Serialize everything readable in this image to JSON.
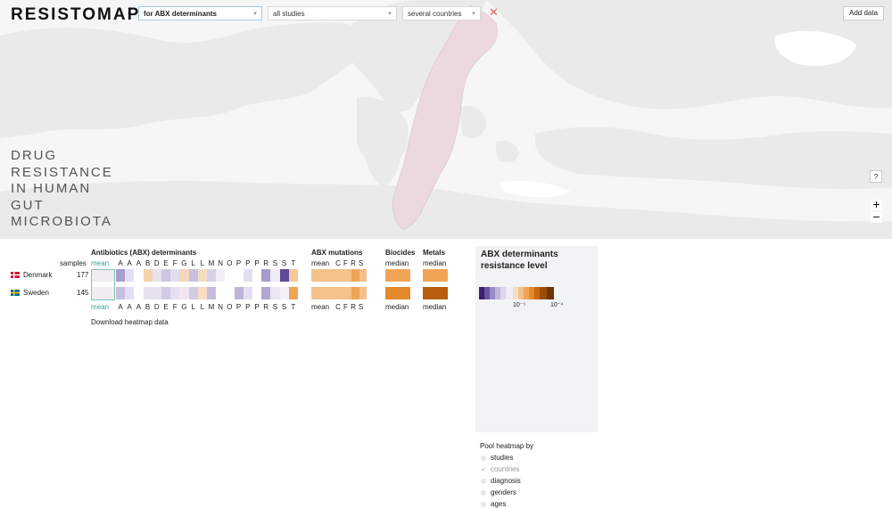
{
  "app": {
    "logo": "RESISTOMAP"
  },
  "filters": {
    "group": "for ABX determinants",
    "studies": "all studies",
    "countries": "several countries",
    "clear_icon": "close-icon"
  },
  "add_data_label": "Add data",
  "tagline": [
    "DRUG",
    "RESISTANCE",
    "IN HUMAN",
    "GUT",
    "MICROBIOTA"
  ],
  "map_controls": {
    "help": "?",
    "zoom_in": "+",
    "zoom_out": "−"
  },
  "heatmap": {
    "section_antibiotics": "Antibiotics (ABX) determinants",
    "section_mutations": "ABX mutations",
    "section_biocides": "Biocides",
    "section_metals": "Metals",
    "samples_label": "samples",
    "mean_label": "mean",
    "median_label": "median",
    "abx_columns": [
      "A",
      "A",
      "A",
      "B",
      "D",
      "E",
      "F",
      "G",
      "L",
      "L",
      "M",
      "N",
      "O",
      "P",
      "P",
      "P",
      "R",
      "S",
      "S",
      "T"
    ],
    "mutation_columns": [
      "C",
      "F",
      "R",
      "S"
    ],
    "rows": [
      {
        "country": "Denmark",
        "samples": "177",
        "flag": "denmark-flag"
      },
      {
        "country": "Sweden",
        "samples": "145",
        "flag": "sweden-flag"
      }
    ],
    "download_label": "Download heatmap data"
  },
  "legend": {
    "title_line1": "ABX determinants",
    "title_line2": "resistance level",
    "tick_low": "10⁻⁵",
    "tick_high": "10⁻⁴"
  },
  "pool": {
    "title": "Pool heatmap by",
    "options": [
      {
        "label": "studies",
        "checked": false
      },
      {
        "label": "countries",
        "checked": true
      },
      {
        "label": "diagnosis",
        "checked": false
      },
      {
        "label": "genders",
        "checked": false
      },
      {
        "label": "ages",
        "checked": false
      }
    ]
  },
  "colors": {
    "accent_teal": "#3a9e93",
    "purple": "#5b3f92",
    "orange": "#c8670e",
    "map_highlight": "#ecd9dd"
  }
}
